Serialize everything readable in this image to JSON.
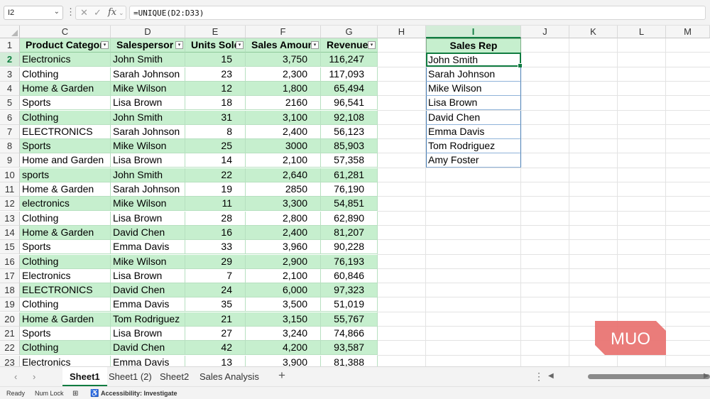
{
  "formula_bar": {
    "name_box": "I2",
    "formula": "=UNIQUE(D2:D33)"
  },
  "columns": [
    "C",
    "D",
    "E",
    "F",
    "G",
    "H",
    "I",
    "J",
    "K",
    "L",
    "M"
  ],
  "selected_column": "I",
  "selected_row": "2",
  "rows": [
    "1",
    "2",
    "3",
    "4",
    "5",
    "6",
    "7",
    "8",
    "9",
    "10",
    "11",
    "12",
    "13",
    "14",
    "15",
    "16",
    "17",
    "18",
    "19",
    "20",
    "21",
    "22",
    "23"
  ],
  "table": {
    "headers": [
      "Product Categor",
      "Salespersor",
      "Units Sold",
      "Sales Amoun",
      "Revenue"
    ],
    "data": [
      [
        "Electronics",
        "John Smith",
        "15",
        "3,750",
        "116,247"
      ],
      [
        "Clothing",
        "Sarah Johnson",
        "23",
        "2,300",
        "117,093"
      ],
      [
        "Home & Garden",
        "Mike Wilson",
        "12",
        "1,800",
        "65,494"
      ],
      [
        "Sports",
        "Lisa Brown",
        "18",
        "2160",
        "96,541"
      ],
      [
        "Clothing",
        "John Smith",
        "31",
        "3,100",
        "92,108"
      ],
      [
        "ELECTRONICS",
        "Sarah Johnson",
        "8",
        "2,400",
        "56,123"
      ],
      [
        "Sports",
        "Mike Wilson",
        "25",
        "3000",
        "85,903"
      ],
      [
        "Home and Garden",
        "Lisa Brown",
        "14",
        "2,100",
        "57,358"
      ],
      [
        "sports",
        "John Smith",
        "22",
        "2,640",
        "61,281"
      ],
      [
        "Home & Garden",
        "Sarah Johnson",
        "19",
        "2850",
        "76,190"
      ],
      [
        "electronics",
        "Mike Wilson",
        "11",
        "3,300",
        "54,851"
      ],
      [
        "Clothing",
        "Lisa Brown",
        "28",
        "2,800",
        "62,890"
      ],
      [
        "Home & Garden",
        "David Chen",
        "16",
        "2,400",
        "81,207"
      ],
      [
        "Sports",
        "Emma Davis",
        "33",
        "3,960",
        "90,228"
      ],
      [
        "Clothing",
        "Mike Wilson",
        "29",
        "2,900",
        "76,193"
      ],
      [
        "Electronics",
        "Lisa Brown",
        "7",
        "2,100",
        "60,846"
      ],
      [
        "ELECTRONICS",
        "David Chen",
        "24",
        "6,000",
        "97,323"
      ],
      [
        "Clothing",
        "Emma Davis",
        "35",
        "3,500",
        "51,019"
      ],
      [
        "Home & Garden",
        "Tom Rodriguez",
        "21",
        "3,150",
        "55,767"
      ],
      [
        "Sports",
        "Lisa Brown",
        "27",
        "3,240",
        "74,866"
      ],
      [
        "Clothing",
        "David Chen",
        "42",
        "4,200",
        "93,587"
      ],
      [
        "Electronics",
        "Emma Davis",
        "13",
        "3,900",
        "81,388"
      ]
    ]
  },
  "unique_list": {
    "header": "Sales Rep",
    "items": [
      "John Smith",
      "Sarah Johnson",
      "Mike Wilson",
      "Lisa Brown",
      "David Chen",
      "Emma Davis",
      "Tom Rodriguez",
      "Amy Foster"
    ]
  },
  "sheet_tabs": [
    "Sheet1",
    "Sheet1 (2)",
    "Sheet2",
    "Sales Analysis"
  ],
  "active_tab": "Sheet1",
  "status_bar": {
    "ready": "Ready",
    "num_lock": "Num Lock",
    "accessibility": "Accessibility: Investigate"
  },
  "watermark": "MUO",
  "colors": {
    "table_band": "#c6efce",
    "accent_green": "#107c41",
    "logo_red": "#e8716f"
  }
}
